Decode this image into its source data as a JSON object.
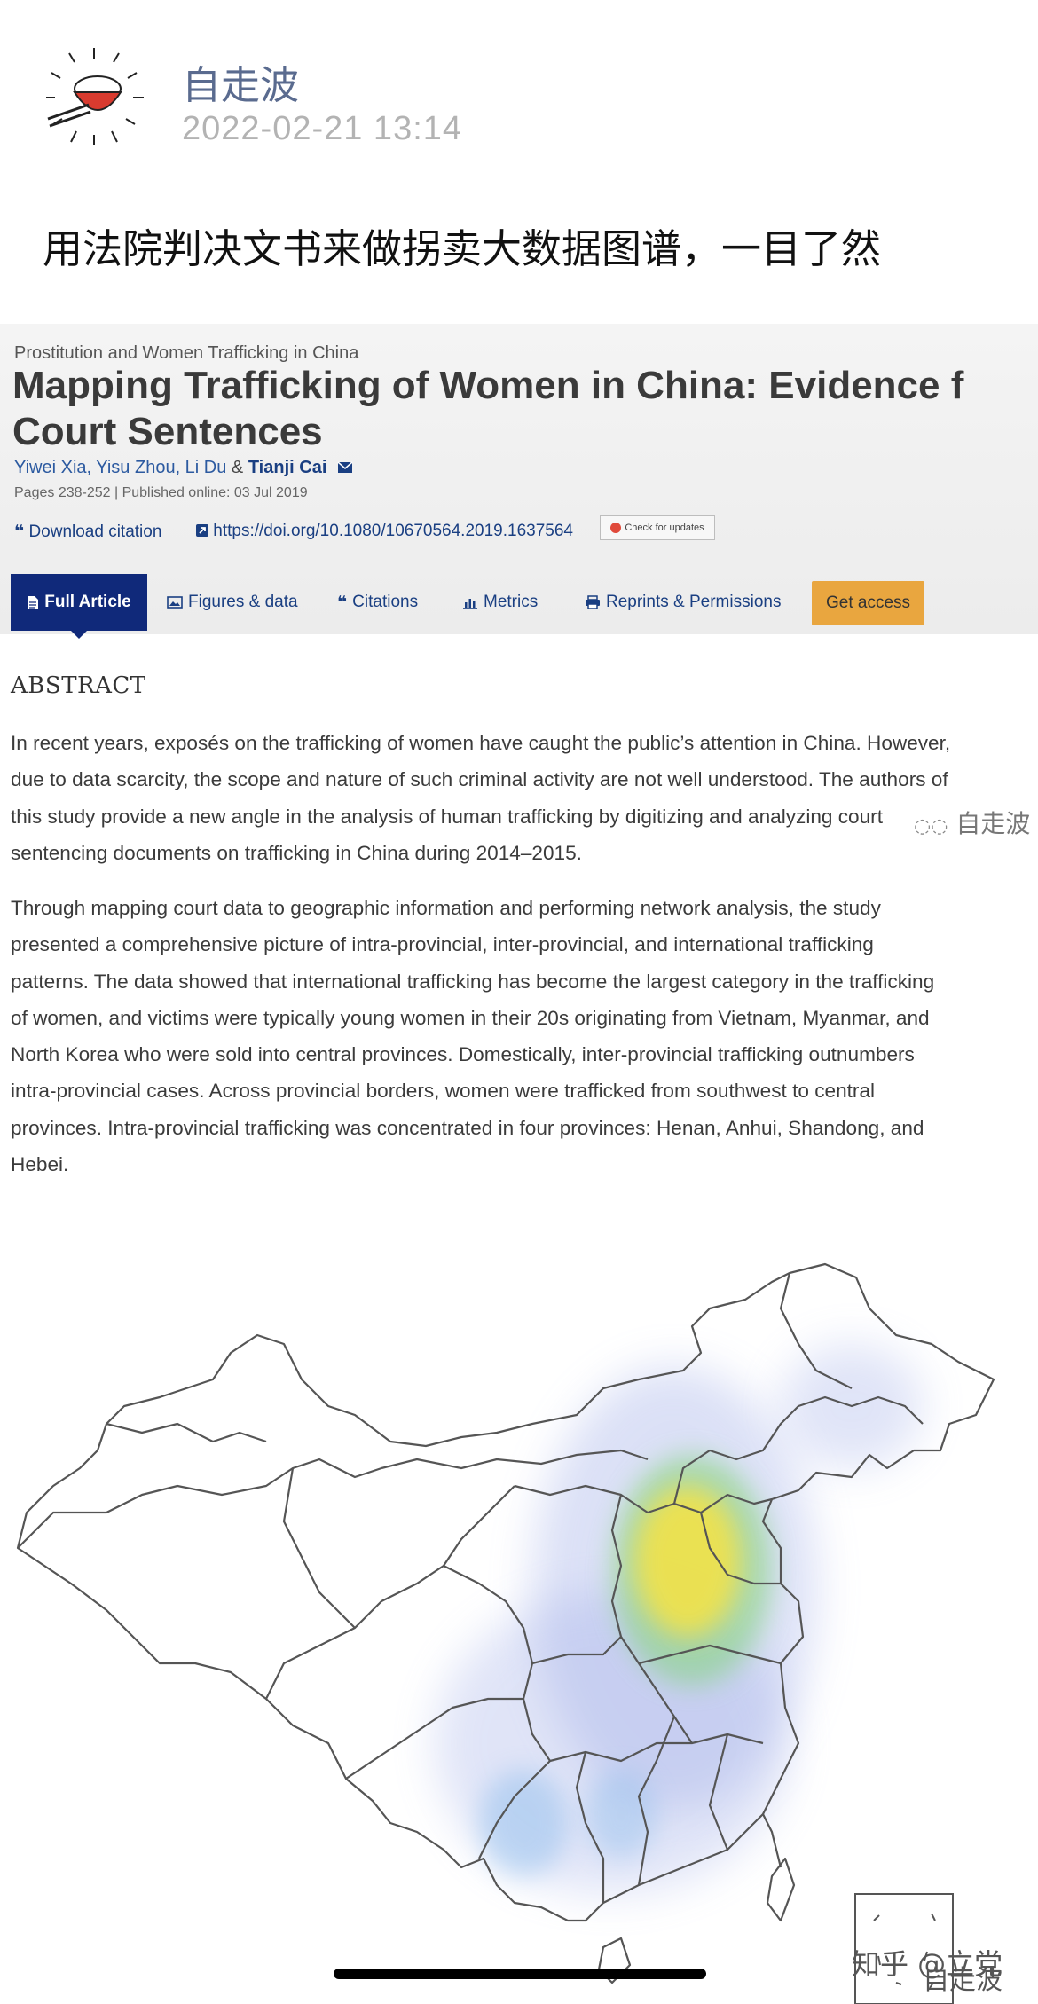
{
  "post": {
    "author": "自走波",
    "datetime": "2022-02-21 13:14",
    "text": "用法院判决文书来做拐卖大数据图谱，一目了然"
  },
  "article": {
    "journal": "Prostitution and Women Trafficking in China",
    "title_line1": "Mapping Trafficking of Women in China: Evidence f",
    "title_line2": "Court Sentences",
    "authors_plain": "Yiwei Xia, Yisu Zhou, Li Du",
    "authors_amp": " & ",
    "author_corresponding": "Tianji Cai",
    "pages": "Pages 238-252 | Published online: 03 Jul 2019",
    "download_citation": "Download citation",
    "doi": "https://doi.org/10.1080/10670564.2019.1637564",
    "check_updates": "Check for updates",
    "tabs": {
      "full_article": "Full Article",
      "figures": "Figures & data",
      "citations": "Citations",
      "metrics": "Metrics",
      "reprints": "Reprints & Permissions",
      "get_access": "Get access"
    },
    "abstract_heading": "ABSTRACT",
    "para1": [
      "In recent years, exposés on the trafficking of women have caught the public’s attention in China. However,",
      "due to data scarcity, the scope and nature of such criminal activity are not well understood. The authors of",
      "this study provide a new angle in the analysis of human trafficking by digitizing and analyzing court",
      "sentencing documents on trafficking in China during 2014–2015."
    ],
    "para2": [
      "Through mapping court data to geographic information and performing network analysis, the study",
      "presented a comprehensive picture of intra-provincial, inter-provincial, and international trafficking",
      "patterns. The data showed that international trafficking has become the largest category in the trafficking",
      "of women, and victims were typically young women in their 20s originating from Vietnam, Myanmar, and",
      "North Korea who were sold into central provinces. Domestically, inter-provincial trafficking outnumbers",
      "intra-provincial cases. Across provincial borders, women were trafficked from southwest to central",
      "provinces. Intra-provincial trafficking was concentrated in four provinces: Henan, Anhui, Shandong, and",
      "Hebei."
    ]
  },
  "watermarks": {
    "wechat": "自走波",
    "zhihu": "知乎 @立党",
    "bottom": "自走波"
  },
  "colors": {
    "tab_active": "#10297a",
    "link": "#1a3f82",
    "get_access": "#e9a63f",
    "heat_core": "#f2e24a",
    "heat_mid": "#a6d86a",
    "heat_outer": "#8d9fe0"
  },
  "icons": {
    "avatar": "rice-bowl-avatar",
    "envelope": "envelope-icon",
    "quote": "quote-icon",
    "external_link": "external-link-icon",
    "document": "document-icon",
    "image": "image-icon",
    "bar_chart": "bar-chart-icon",
    "printer": "printer-icon"
  }
}
